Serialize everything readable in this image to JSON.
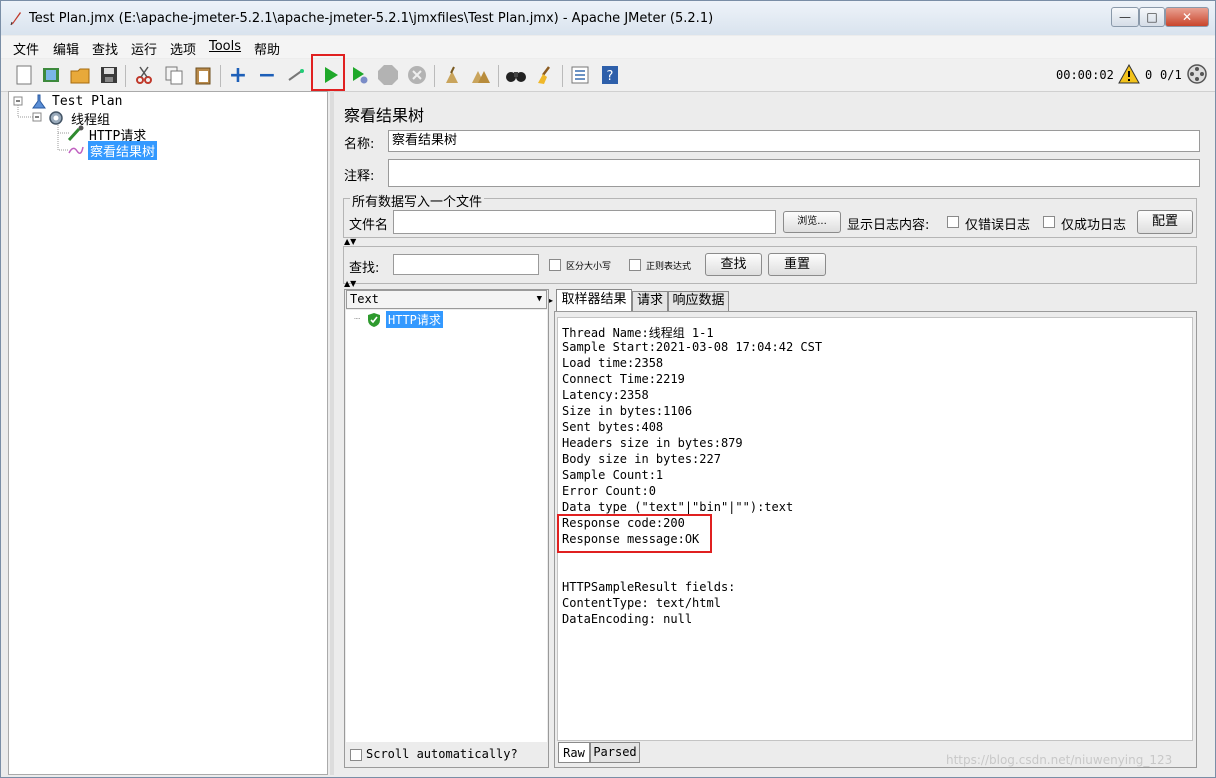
{
  "window": {
    "title": "Test Plan.jmx (E:\\apache-jmeter-5.2.1\\apache-jmeter-5.2.1\\jmxfiles\\Test Plan.jmx) - Apache JMeter (5.2.1)",
    "min_label": "—",
    "max_label": "□",
    "close_label": "✕"
  },
  "menu": [
    "文件",
    "编辑",
    "查找",
    "运行",
    "选项",
    "Tools",
    "帮助"
  ],
  "toolbar": {
    "timer": "00:00:02",
    "warn_count": "0",
    "threads": "0/1"
  },
  "tree": {
    "test_plan": "Test Plan",
    "thread_group": "线程组",
    "http_request": "HTTP请求",
    "result_tree": "察看结果树"
  },
  "panel": {
    "title": "察看结果树",
    "name_label": "名称:",
    "name_value": "察看结果树",
    "comment_label": "注释:",
    "comment_value": "",
    "file_group_title": "所有数据写入一个文件",
    "filename_label": "文件名",
    "filename_value": "",
    "browse_label": "浏览...",
    "log_content_label": "显示日志内容:",
    "errors_only_label": "仅错误日志",
    "success_only_label": "仅成功日志",
    "config_label": "配置",
    "search_label": "查找:",
    "search_value": "",
    "case_sensitive_label": "区分大小写",
    "regex_label": "正则表达式",
    "find_label": "查找",
    "reset_label": "重置"
  },
  "results": {
    "renderer": "Text",
    "sample_item": "HTTP请求",
    "scroll_auto_label": "Scroll automatically?",
    "tabs": [
      "取样器结果",
      "请求",
      "响应数据"
    ],
    "lines": [
      "Thread Name:线程组 1-1",
      "Sample Start:2021-03-08 17:04:42 CST",
      "Load time:2358",
      "Connect Time:2219",
      "Latency:2358",
      "Size in bytes:1106",
      "Sent bytes:408",
      "Headers size in bytes:879",
      "Body size in bytes:227",
      "Sample Count:1",
      "Error Count:0",
      "Data type (\"text\"|\"bin\"|\"\"):text",
      "Response code:200",
      "Response message:OK",
      "",
      "",
      "HTTPSampleResult fields:",
      "ContentType: text/html",
      "DataEncoding: null"
    ],
    "bottom_tabs": [
      "Raw",
      "Parsed"
    ]
  },
  "watermark": "https://blog.csdn.net/niuwenying_123",
  "colors": {
    "accent_red": "#e02020",
    "selection_blue": "#3399ff",
    "play_green": "#1fa82a"
  }
}
